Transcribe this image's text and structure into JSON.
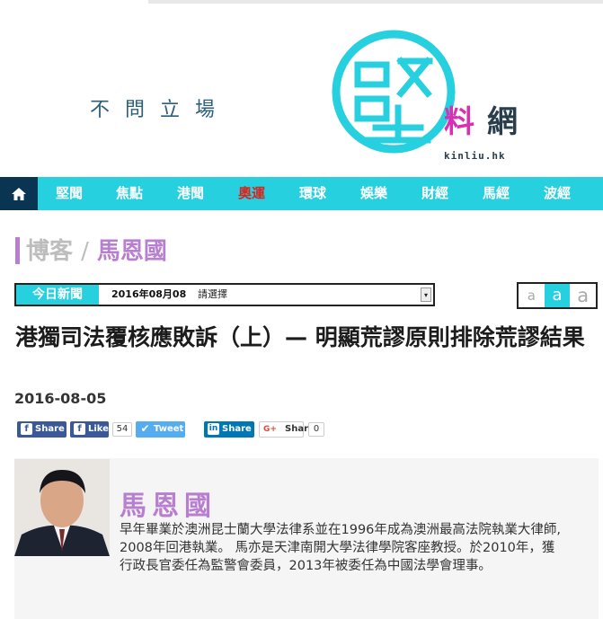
{
  "header": {
    "slogan": "不問立場",
    "logo_main": "堅",
    "logo_sub1": "料",
    "logo_sub2": "網",
    "logo_domain": "kinliu.hk"
  },
  "nav": {
    "home_icon": "home-icon",
    "items": [
      "堅聞",
      "焦點",
      "港聞",
      "奧運",
      "環球",
      "娛樂",
      "財經",
      "馬經",
      "波經"
    ]
  },
  "section": {
    "category": "博客",
    "separator": "/",
    "author": "馬恩國"
  },
  "today_bar": {
    "label": "今日新聞",
    "date": "2016年08月08",
    "select": "請選擇"
  },
  "font_size": {
    "options": [
      "a",
      "a",
      "a"
    ],
    "active_index": 1
  },
  "article": {
    "title": "港獨司法覆核應敗訴（上）— 明顯荒謬原則排除荒謬結果",
    "date": "2016-08-05"
  },
  "share": {
    "facebook_share": "Share",
    "facebook_like": "Like",
    "like_count": "54",
    "tweet": "Tweet",
    "linkedin_share": "Share",
    "linkedin_mark": "in",
    "google_share": "Share",
    "google_mark": "G+",
    "google_count": "0"
  },
  "author": {
    "name": "馬恩國",
    "bio": "早年畢業於澳洲昆士蘭大學法律系並在1996年成為澳洲最高法院執業大律師, 2008年回港執業。 馬亦是天津南開大學法律學院客座教授。於2010年，獲行政長官委任為監警會委員，2013年被委任為中國法學會理事。"
  },
  "colors": {
    "accent": "#27d0df",
    "purple": "#b87fd0",
    "magenta": "#d92fb3",
    "navy": "#0a3552",
    "hot": "#d9231d",
    "facebook": "#3b5998",
    "twitter": "#55acee",
    "linkedin": "#0077b5"
  }
}
